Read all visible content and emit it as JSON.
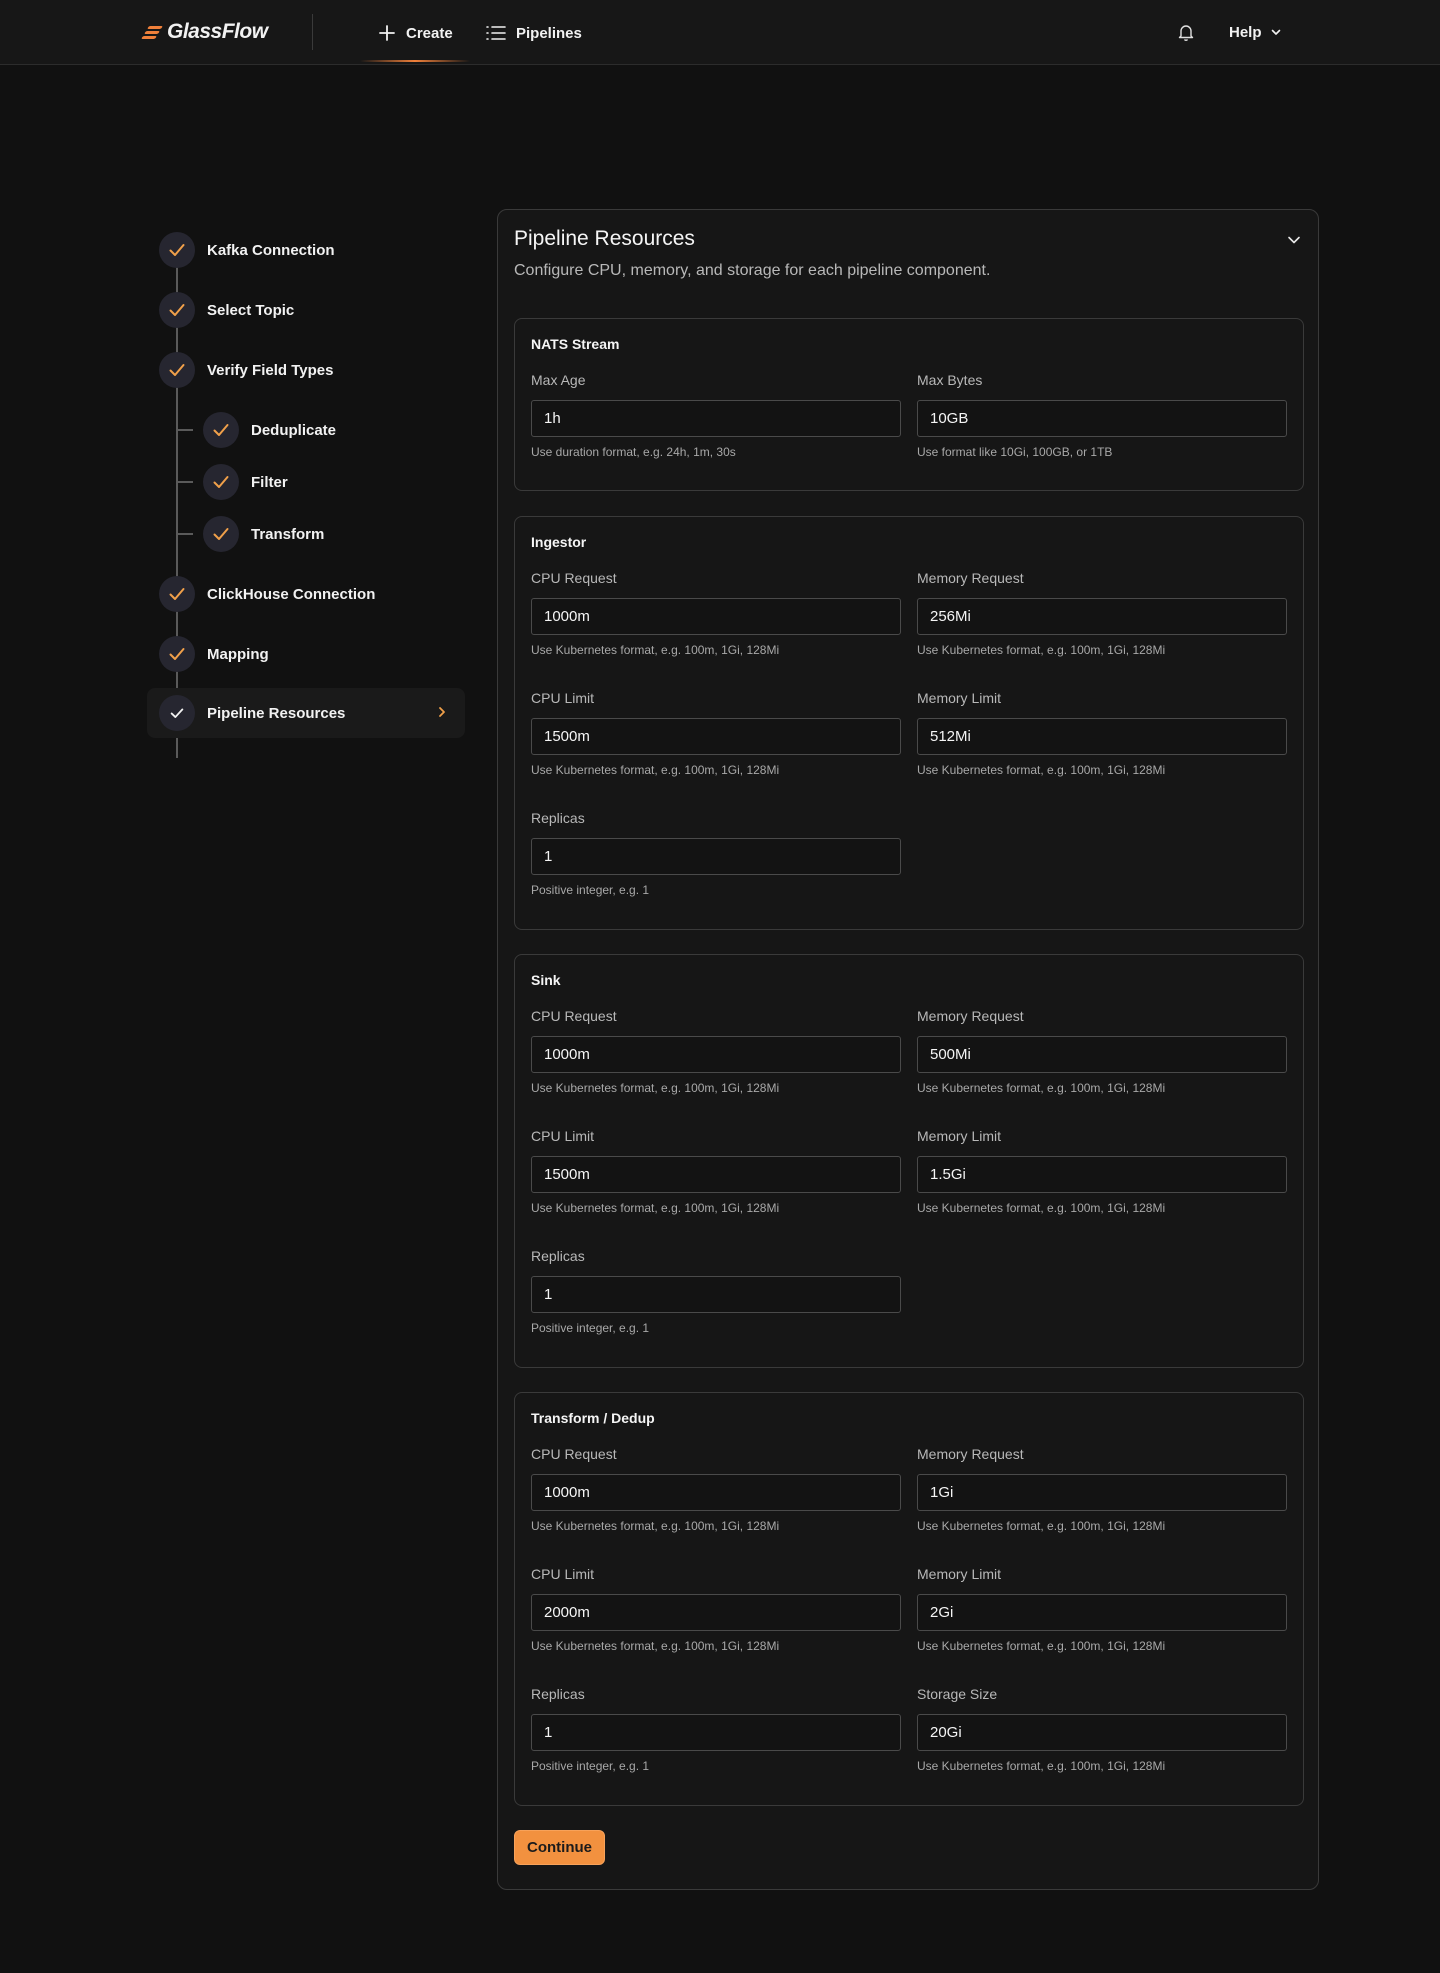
{
  "brand": {
    "name": "GlassFlow",
    "accent": "#f0803a"
  },
  "nav": {
    "create_label": "Create",
    "pipelines_label": "Pipelines",
    "help_label": "Help"
  },
  "steps": [
    {
      "label": "Kafka Connection",
      "done": true
    },
    {
      "label": "Select Topic",
      "done": true
    },
    {
      "label": "Verify Field Types",
      "done": true
    },
    {
      "label": "Deduplicate",
      "done": true,
      "sub": true
    },
    {
      "label": "Filter",
      "done": true,
      "sub": true
    },
    {
      "label": "Transform",
      "done": true,
      "sub": true
    },
    {
      "label": "ClickHouse Connection",
      "done": true
    },
    {
      "label": "Mapping",
      "done": true
    },
    {
      "label": "Pipeline Resources",
      "done": true,
      "active": true
    }
  ],
  "card": {
    "title": "Pipeline Resources",
    "subtitle": "Configure CPU, memory, and storage for each pipeline component."
  },
  "sections": {
    "nats": {
      "title": "NATS Stream",
      "max_age": {
        "label": "Max Age",
        "value": "1h",
        "help": "Use duration format, e.g. 24h, 1m, 30s"
      },
      "max_bytes": {
        "label": "Max Bytes",
        "value": "10GB",
        "help": "Use format like 10Gi, 100GB, or 1TB"
      }
    },
    "ingestor": {
      "title": "Ingestor",
      "cpu_request": {
        "label": "CPU Request",
        "value": "1000m",
        "help": "Use Kubernetes format, e.g. 100m, 1Gi, 128Mi"
      },
      "memory_request": {
        "label": "Memory Request",
        "value": "256Mi",
        "help": "Use Kubernetes format, e.g. 100m, 1Gi, 128Mi"
      },
      "cpu_limit": {
        "label": "CPU Limit",
        "value": "1500m",
        "help": "Use Kubernetes format, e.g. 100m, 1Gi, 128Mi"
      },
      "memory_limit": {
        "label": "Memory Limit",
        "value": "512Mi",
        "help": "Use Kubernetes format, e.g. 100m, 1Gi, 128Mi"
      },
      "replicas": {
        "label": "Replicas",
        "value": "1",
        "help": "Positive integer, e.g. 1"
      }
    },
    "sink": {
      "title": "Sink",
      "cpu_request": {
        "label": "CPU Request",
        "value": "1000m",
        "help": "Use Kubernetes format, e.g. 100m, 1Gi, 128Mi"
      },
      "memory_request": {
        "label": "Memory Request",
        "value": "500Mi",
        "help": "Use Kubernetes format, e.g. 100m, 1Gi, 128Mi"
      },
      "cpu_limit": {
        "label": "CPU Limit",
        "value": "1500m",
        "help": "Use Kubernetes format, e.g. 100m, 1Gi, 128Mi"
      },
      "memory_limit": {
        "label": "Memory Limit",
        "value": "1.5Gi",
        "help": "Use Kubernetes format, e.g. 100m, 1Gi, 128Mi"
      },
      "replicas": {
        "label": "Replicas",
        "value": "1",
        "help": "Positive integer, e.g. 1"
      }
    },
    "transform": {
      "title": "Transform / Dedup",
      "cpu_request": {
        "label": "CPU Request",
        "value": "1000m",
        "help": "Use Kubernetes format, e.g. 100m, 1Gi, 128Mi"
      },
      "memory_request": {
        "label": "Memory Request",
        "value": "1Gi",
        "help": "Use Kubernetes format, e.g. 100m, 1Gi, 128Mi"
      },
      "cpu_limit": {
        "label": "CPU Limit",
        "value": "2000m",
        "help": "Use Kubernetes format, e.g. 100m, 1Gi, 128Mi"
      },
      "memory_limit": {
        "label": "Memory Limit",
        "value": "2Gi",
        "help": "Use Kubernetes format, e.g. 100m, 1Gi, 128Mi"
      },
      "replicas": {
        "label": "Replicas",
        "value": "1",
        "help": "Positive integer, e.g. 1"
      },
      "storage_size": {
        "label": "Storage Size",
        "value": "20Gi",
        "help": "Use Kubernetes format, e.g. 100m, 1Gi, 128Mi"
      }
    }
  },
  "continue_label": "Continue"
}
